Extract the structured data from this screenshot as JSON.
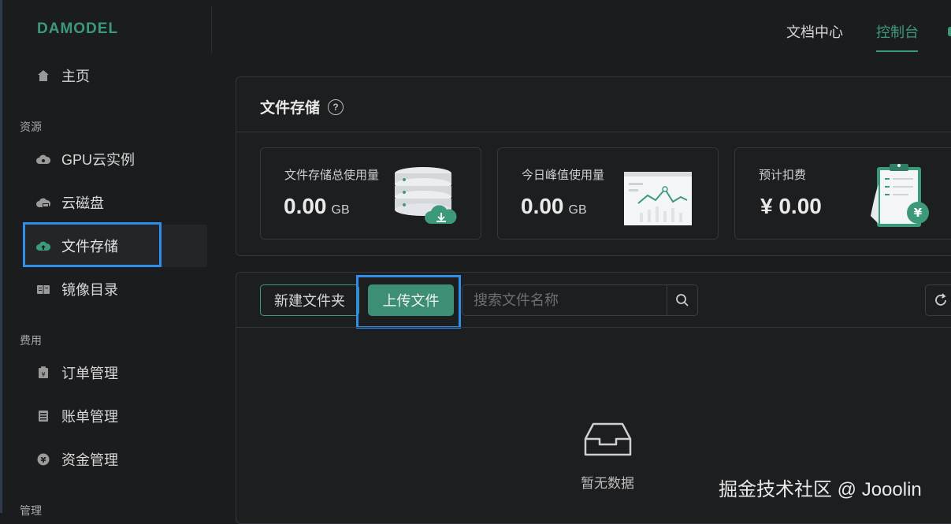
{
  "brand": {
    "logo": "DAMODEL",
    "accent_color": "#3c9a7b",
    "highlight_color": "#2e8eea"
  },
  "topnav": {
    "docs": "文档中心",
    "console": "控制台"
  },
  "sidebar": {
    "home": "主页",
    "group_resources": "资源",
    "gpu": "GPU云实例",
    "cloud_disk": "云磁盘",
    "file_storage": "文件存储",
    "image_dir": "镜像目录",
    "group_billing": "费用",
    "orders": "订单管理",
    "bills": "账单管理",
    "funds": "资金管理",
    "group_manage": "管理"
  },
  "page": {
    "title": "文件存储",
    "stats": [
      {
        "label": "文件存储总使用量",
        "value": "0.00",
        "unit": "GB"
      },
      {
        "label": "今日峰值使用量",
        "value": "0.00",
        "unit": "GB"
      },
      {
        "label": "预计扣费",
        "value": "¥ 0.00",
        "unit": ""
      }
    ],
    "new_folder": "新建文件夹",
    "upload": "上传文件",
    "search_placeholder": "搜索文件名称",
    "empty": "暂无数据"
  },
  "watermark": "掘金技术社区 @ Jooolin"
}
